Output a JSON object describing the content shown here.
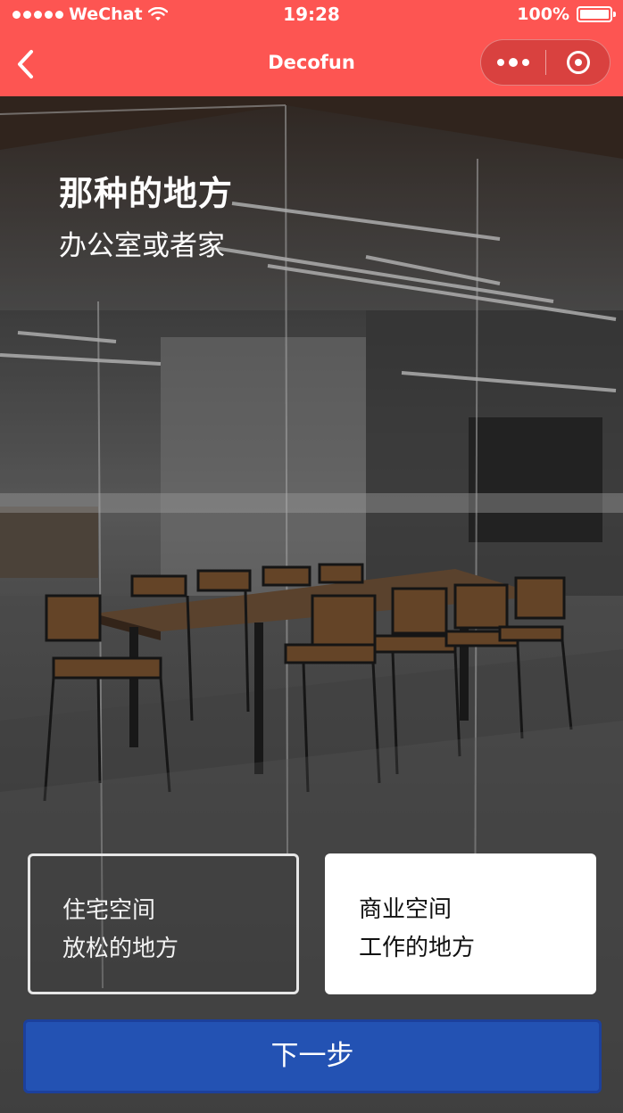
{
  "status_bar": {
    "carrier": "WeChat",
    "time": "19:28",
    "battery": "100%"
  },
  "nav": {
    "title": "Decofun",
    "back_icon": "chevron-left-icon",
    "more_icon": "more-dots-icon",
    "close_icon": "target-circle-icon"
  },
  "hero": {
    "title": "那种的地方",
    "subtitle": "办公室或者家"
  },
  "options": [
    {
      "line1": "住宅空间",
      "line2": "放松的地方",
      "selected": false
    },
    {
      "line1": "商业空间",
      "line2": "工作的地方",
      "selected": true
    }
  ],
  "next_button": {
    "label": "下一步"
  },
  "colors": {
    "header": "#fd5552",
    "primary_button": "#2352b3",
    "selected_card": "#ffffff"
  }
}
